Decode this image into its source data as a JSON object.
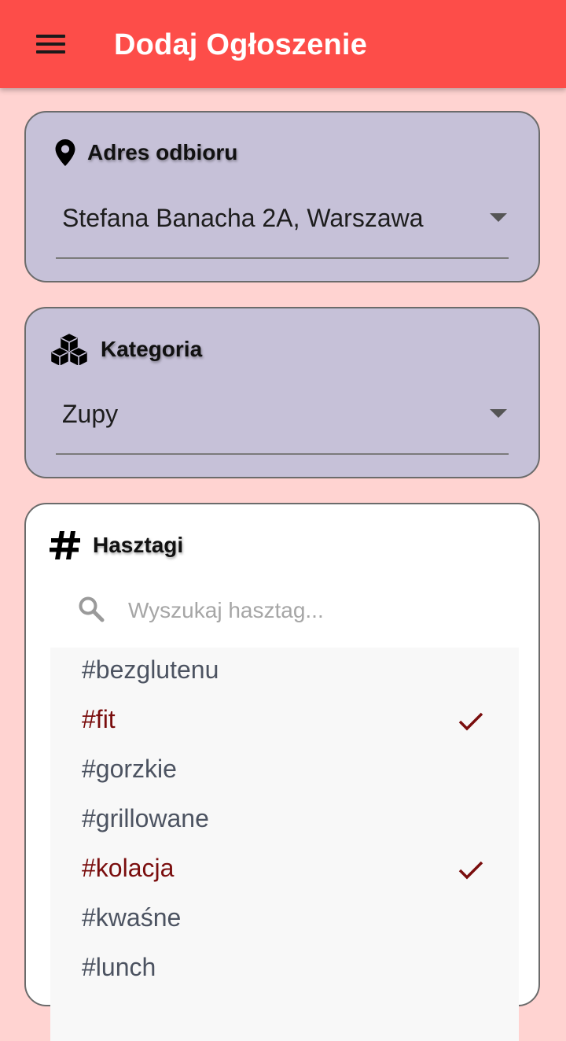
{
  "appbar": {
    "title": "Dodaj Ogłoszenie",
    "menu_icon": "hamburger-menu-icon"
  },
  "address": {
    "title": "Adres odbioru",
    "icon": "location-pin-icon",
    "value": "Stefana Banacha 2A, Warszawa"
  },
  "category": {
    "title": "Kategoria",
    "icon": "cubes-icon",
    "value": "Zupy"
  },
  "hashtags": {
    "title": "Hasztagi",
    "icon": "hashtag-icon",
    "search_placeholder": "Wyszukaj hasztag...",
    "items": [
      {
        "label": "#bezglutenu",
        "selected": false
      },
      {
        "label": "#fit",
        "selected": true
      },
      {
        "label": "#gorzkie",
        "selected": false
      },
      {
        "label": "#grillowane",
        "selected": false
      },
      {
        "label": "#kolacja",
        "selected": true
      },
      {
        "label": "#kwaśne",
        "selected": false
      },
      {
        "label": "#lunch",
        "selected": false
      }
    ]
  },
  "colors": {
    "appbar": "#fd4d49",
    "background": "#ffd3d1",
    "card": "#c6c1d8",
    "selected_tag": "#7a0d0d",
    "tag": "#4c5361"
  }
}
